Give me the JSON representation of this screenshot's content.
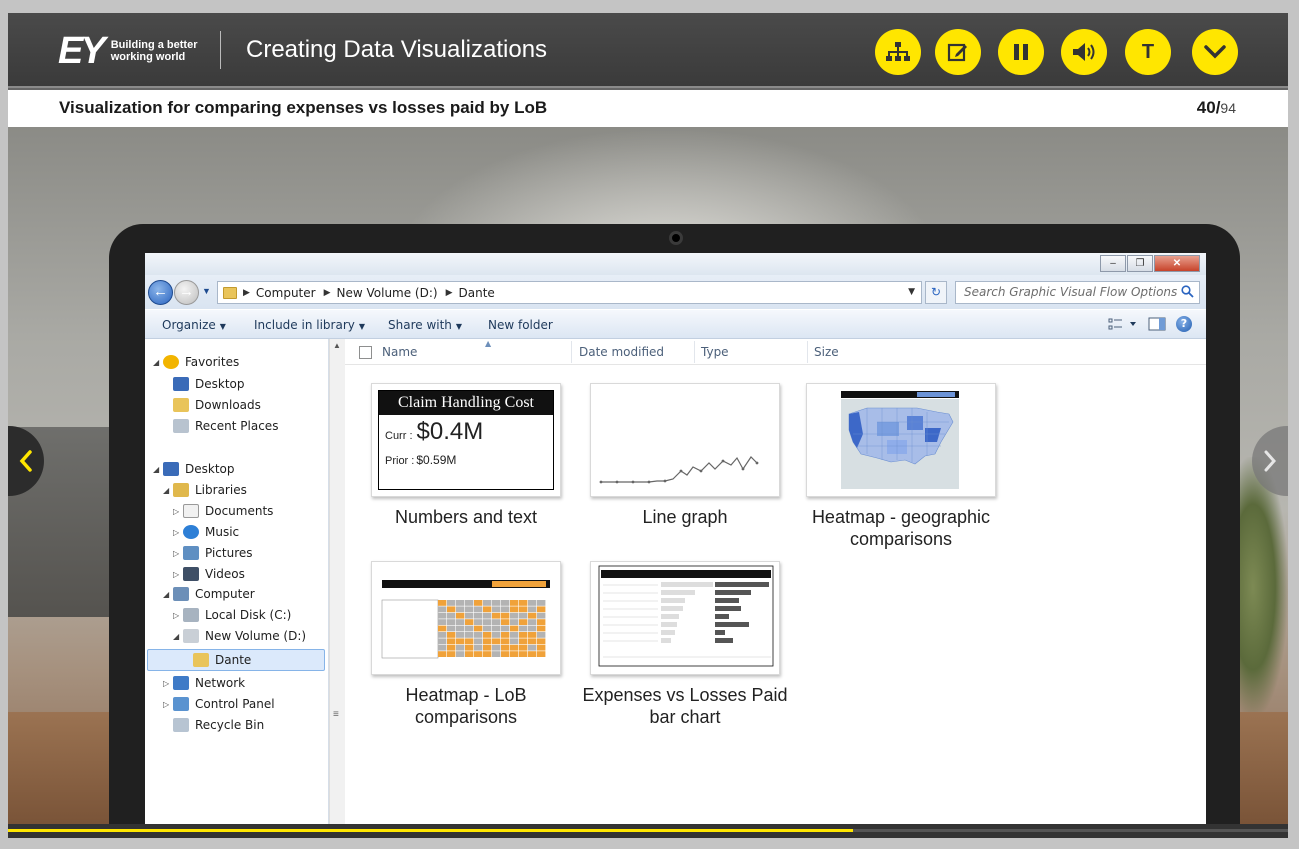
{
  "header": {
    "logo_mark": "EY",
    "logo_tagline": "Building a better working world",
    "course_title": "Creating Data Visualizations",
    "buttons": [
      {
        "name": "sitemap-button",
        "icon": "sitemap-icon"
      },
      {
        "name": "notes-button",
        "icon": "edit-icon"
      },
      {
        "name": "pause-button",
        "icon": "pause-icon"
      },
      {
        "name": "volume-button",
        "icon": "speaker-icon"
      },
      {
        "name": "transcript-button",
        "icon": "text-icon",
        "label": "T"
      },
      {
        "name": "menu-button",
        "icon": "chevron-down-icon"
      }
    ],
    "accent_color": "#ffe600"
  },
  "slide": {
    "title": "Visualization for comparing expenses vs losses paid by LoB",
    "page_current": "40/",
    "page_total": "94"
  },
  "explorer": {
    "window_controls": [
      "–",
      "❐",
      "✕"
    ],
    "address": {
      "crumbs": [
        "Computer",
        "New Volume (D:)",
        "Dante"
      ]
    },
    "search": {
      "placeholder": "Search Graphic Visual Flow Options"
    },
    "commands": {
      "organize": "Organize",
      "include": "Include in library",
      "share": "Share with",
      "new_folder": "New folder"
    },
    "columns": [
      "Name",
      "Date modified",
      "Type",
      "Size"
    ],
    "nav": {
      "favorites": "Favorites",
      "desktop1": "Desktop",
      "downloads": "Downloads",
      "recent": "Recent Places",
      "desktop2": "Desktop",
      "libraries": "Libraries",
      "documents": "Documents",
      "music": "Music",
      "pictures": "Pictures",
      "videos": "Videos",
      "computer": "Computer",
      "local_disk": "Local Disk (C:)",
      "new_volume": "New Volume (D:)",
      "dante": "Dante",
      "network": "Network",
      "control_panel": "Control Panel",
      "recycle_bin": "Recycle Bin"
    },
    "files": [
      {
        "label": "Numbers and text"
      },
      {
        "label": "Line graph"
      },
      {
        "label": "Heatmap - geographic comparisons"
      },
      {
        "label": "Heatmap - LoB comparisons"
      },
      {
        "label": "Expenses vs Losses Paid bar chart"
      }
    ],
    "kpi_thumb": {
      "title": "Claim Handling Cost",
      "curr_label": "Curr :",
      "curr_value": "$0.4M",
      "prior_label": "Prior :",
      "prior_value": "$0.59M"
    }
  },
  "player": {
    "progress": 0.66
  }
}
